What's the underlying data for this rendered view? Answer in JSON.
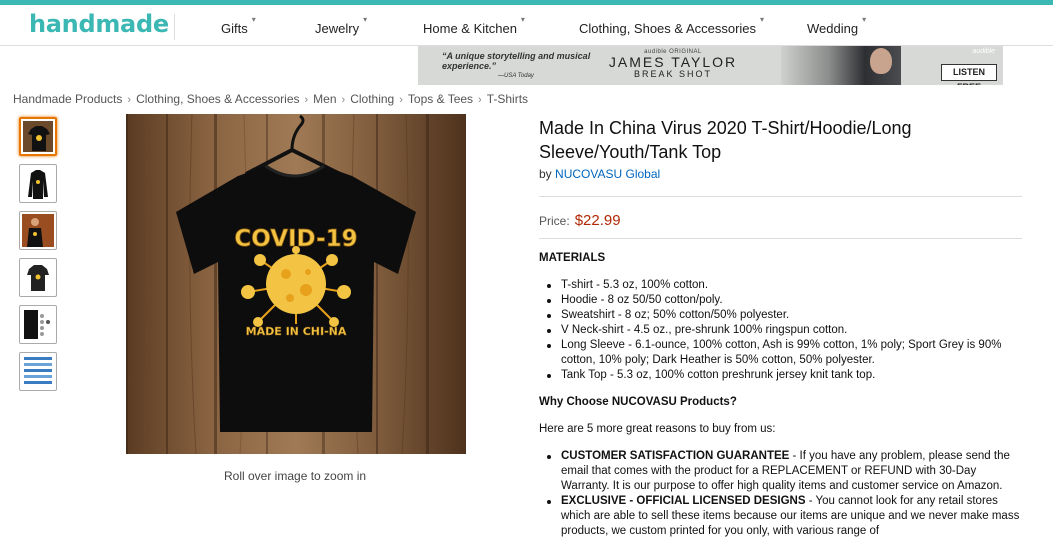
{
  "logo": "handmade",
  "nav": [
    {
      "label": "Gifts"
    },
    {
      "label": "Jewelry"
    },
    {
      "label": "Home & Kitchen"
    },
    {
      "label": "Clothing, Shoes & Accessories"
    },
    {
      "label": "Wedding"
    }
  ],
  "ad": {
    "quote": "“A unique storytelling and musical experience.”",
    "quote_source": "—USA Today",
    "tag": "audible ORIGINAL",
    "title": "JAMES TAYLOR",
    "subtitle": "BREAK SHOT",
    "brand": "audible",
    "cta": "LISTEN FREE"
  },
  "breadcrumb": [
    "Handmade Products",
    "Clothing, Shoes & Accessories",
    "Men",
    "Clothing",
    "Tops & Tees",
    "T-Shirts"
  ],
  "main_image": {
    "shirt_title": "COVID-19",
    "shirt_subtitle": "MADE IN CHI-NA",
    "zoom_hint": "Roll over image to zoom in"
  },
  "product": {
    "title": "Made In China Virus 2020 T-Shirt/Hoodie/Long Sleeve/Youth/Tank Top",
    "by_label": "by",
    "brand": "NUCOVASU Global",
    "price_label": "Price:",
    "price": "$22.99",
    "materials_heading": "MATERIALS",
    "materials": [
      "T-shirt - 5.3 oz, 100% cotton.",
      "Hoodie - 8 oz 50/50 cotton/poly.",
      "Sweatshirt - 8 oz; 50% cotton/50% polyester.",
      "V Neck-shirt - 4.5 oz., pre-shrunk 100% ringspun cotton.",
      "Long Sleeve - 6.1-ounce, 100% cotton, Ash is 99% cotton, 1% poly; Sport Grey is 90% cotton, 10% poly; Dark Heather is 50% cotton, 50% polyester.",
      "Tank Top - 5.3 oz, 100% cotton preshrunk jersey knit tank top."
    ],
    "why_heading": "Why Choose NUCOVASU Products?",
    "reasons_intro": "Here are 5 more great reasons to buy from us:",
    "reasons": [
      {
        "lead": "CUSTOMER SATISFACTION GUARANTEE",
        "text": " - If you have any problem, please send the email that comes with the product for a REPLACEMENT or REFUND with 30-Day Warranty. It is our purpose to offer high quality items and customer service on Amazon."
      },
      {
        "lead": "EXCLUSIVE - OFFICIAL LICENSED DESIGNS",
        "text": " - You cannot look for any retail stores which are able to sell these items because our items are unique and we never make mass products, we custom printed for you only, with various range of"
      }
    ]
  },
  "colors": {
    "brand": "#3bb8b3",
    "price": "#b12704",
    "link": "#0066c0",
    "thumb_active": "#e77600"
  }
}
